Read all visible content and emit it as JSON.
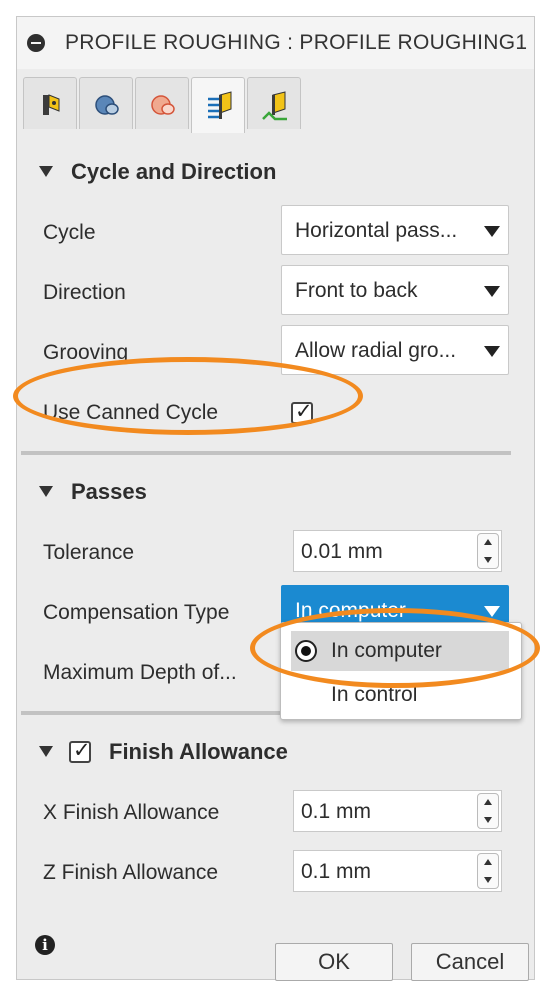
{
  "dialog": {
    "title": "PROFILE ROUGHING : PROFILE ROUGHING1",
    "tabs": [
      {
        "icon": "tool-icon",
        "active": false
      },
      {
        "icon": "geometry-icon",
        "active": false
      },
      {
        "icon": "heights-icon",
        "active": false
      },
      {
        "icon": "passes-icon",
        "active": true
      },
      {
        "icon": "linking-icon",
        "active": false
      }
    ]
  },
  "cycle_section": {
    "title": "Cycle and Direction",
    "cycle_label": "Cycle",
    "cycle_value": "Horizontal pass...",
    "direction_label": "Direction",
    "direction_value": "Front to back",
    "grooving_label": "Grooving",
    "grooving_value": "Allow radial gro...",
    "canned_label": "Use Canned Cycle",
    "canned_checked": true
  },
  "passes_section": {
    "title": "Passes",
    "tolerance_label": "Tolerance",
    "tolerance_value": "0.01 mm",
    "compensation_label": "Compensation Type",
    "compensation_value": "In computer",
    "max_depth_label": "Maximum Depth of...",
    "dropdown_options": [
      "In computer",
      "In control"
    ],
    "dropdown_selected": "In computer"
  },
  "finish_section": {
    "title": "Finish Allowance",
    "enabled": true,
    "x_label": "X Finish Allowance",
    "x_value": "0.1 mm",
    "z_label": "Z Finish Allowance",
    "z_value": "0.1 mm"
  },
  "footer": {
    "info_icon": "info-icon",
    "ok_label": "OK",
    "cancel_label": "Cancel"
  },
  "colors": {
    "highlight_ring": "#f28a1f",
    "select_active": "#1b8ad1"
  }
}
